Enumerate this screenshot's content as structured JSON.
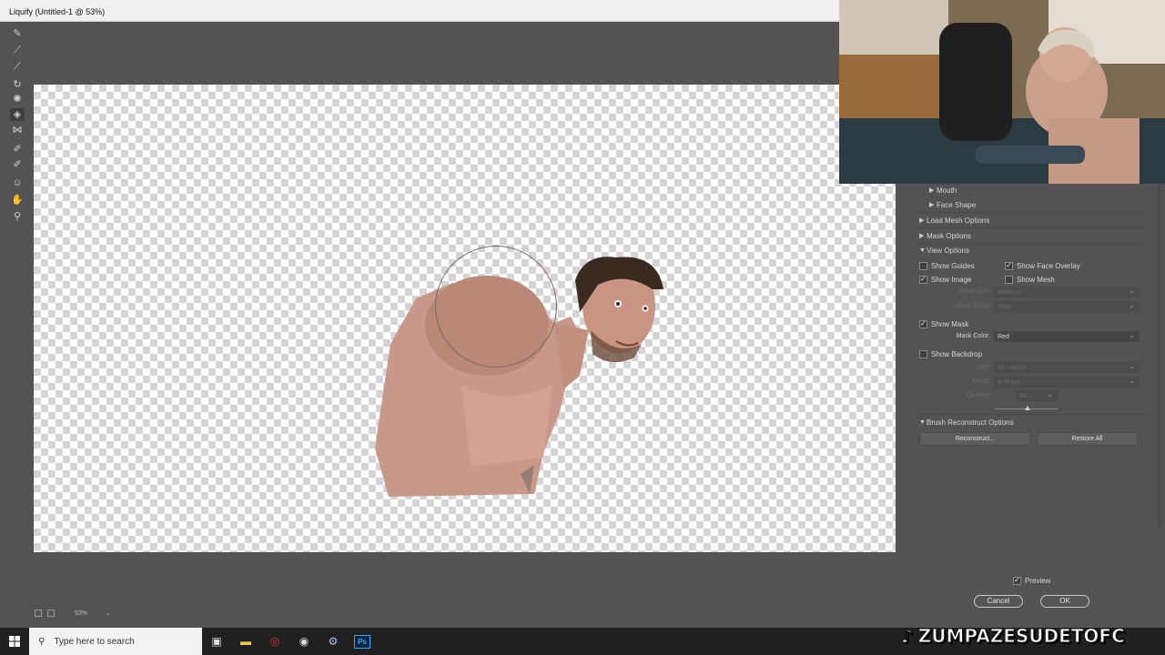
{
  "window": {
    "title": "Liquify (Untitled-1 @ 53%)"
  },
  "toolbar": {
    "tools": [
      "forward-warp",
      "reconstruct",
      "smooth",
      "twirl",
      "pucker",
      "bloat",
      "push-left",
      "freeze-mask",
      "thaw-mask",
      "face",
      "hand",
      "zoom"
    ],
    "active_tool": "bloat"
  },
  "status": {
    "zoom": "53%"
  },
  "panel": {
    "face_aware": {
      "mouth": "Mouth",
      "face_shape": "Face Shape"
    },
    "load_mesh_options": "Load Mesh Options",
    "mask_options": "Mask Options",
    "view_options": {
      "header": "View Options",
      "show_guides": "Show Guides",
      "show_face_overlay": "Show Face Overlay",
      "show_image": "Show Image",
      "show_mesh": "Show Mesh",
      "mesh_size_label": "Mesh Size:",
      "mesh_size_value": "Medium",
      "mesh_color_label": "Mesh Color:",
      "mesh_color_value": "Gray",
      "show_mask": "Show Mask",
      "mask_color_label": "Mask Color:",
      "mask_color_value": "Red",
      "show_backdrop": "Show Backdrop",
      "use_label": "Use:",
      "use_value": "All Layers",
      "mode_label": "Mode:",
      "mode_value": "In Front",
      "opacity_label": "Opacity:",
      "opacity_value": "50"
    },
    "checks": {
      "show_guides": false,
      "show_face_overlay": true,
      "show_image": true,
      "show_mesh": false,
      "show_mask": true,
      "show_backdrop": false,
      "preview": true
    },
    "brush_reconstruct": {
      "header": "Brush Reconstruct Options",
      "reconstruct_button": "Reconstruct...",
      "restore_all_button": "Restore All"
    },
    "preview": "Preview",
    "cancel": "Cancel",
    "ok": "OK"
  },
  "taskbar": {
    "search_placeholder": "Type here to search"
  },
  "watermark": "ZUMPAZESUDETOFC",
  "colors": {
    "ui_bg": "#535353",
    "skin": "#c4937e",
    "taskbar": "#202020"
  }
}
